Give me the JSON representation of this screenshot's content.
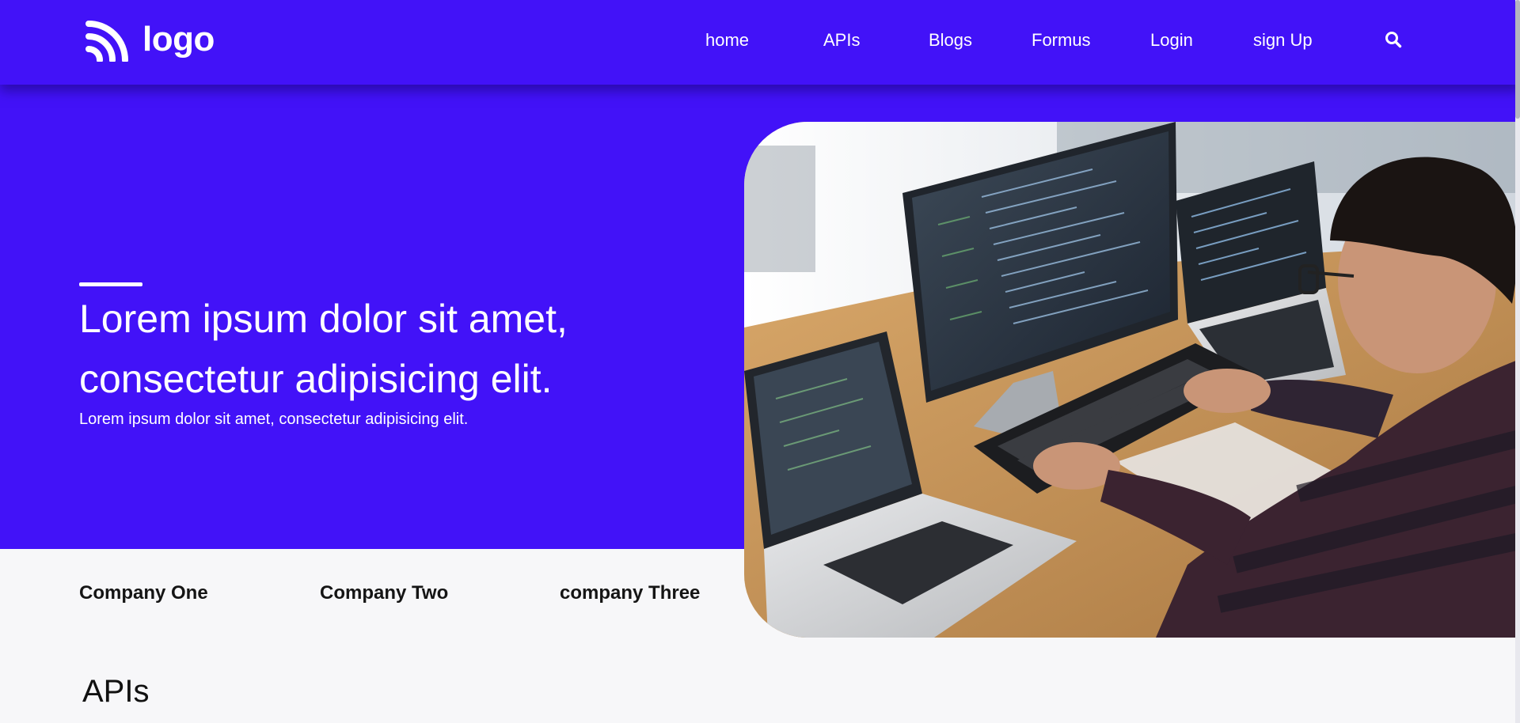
{
  "header": {
    "logo_text": "logo",
    "nav": [
      {
        "label": "home"
      },
      {
        "label": "APIs"
      },
      {
        "label": "Blogs"
      },
      {
        "label": "Formus"
      },
      {
        "label": "Login"
      },
      {
        "label": "sign Up"
      }
    ],
    "search_icon": "search-icon"
  },
  "hero": {
    "title_line1": "Lorem ipsum dolor sit amet,",
    "title_line2": "consectetur adipisicing elit.",
    "subtitle": "Lorem ipsum dolor sit amet, consectetur adipisicing elit.",
    "image": "person coding at desk with monitors and laptops"
  },
  "companies": [
    {
      "label": "Company One"
    },
    {
      "label": "Company Two"
    },
    {
      "label": "company Three"
    }
  ],
  "sections": {
    "apis_title": "APIs"
  },
  "colors": {
    "brand": "#4212f8",
    "page_background": "#f7f7f9",
    "text_dark": "#151515"
  }
}
